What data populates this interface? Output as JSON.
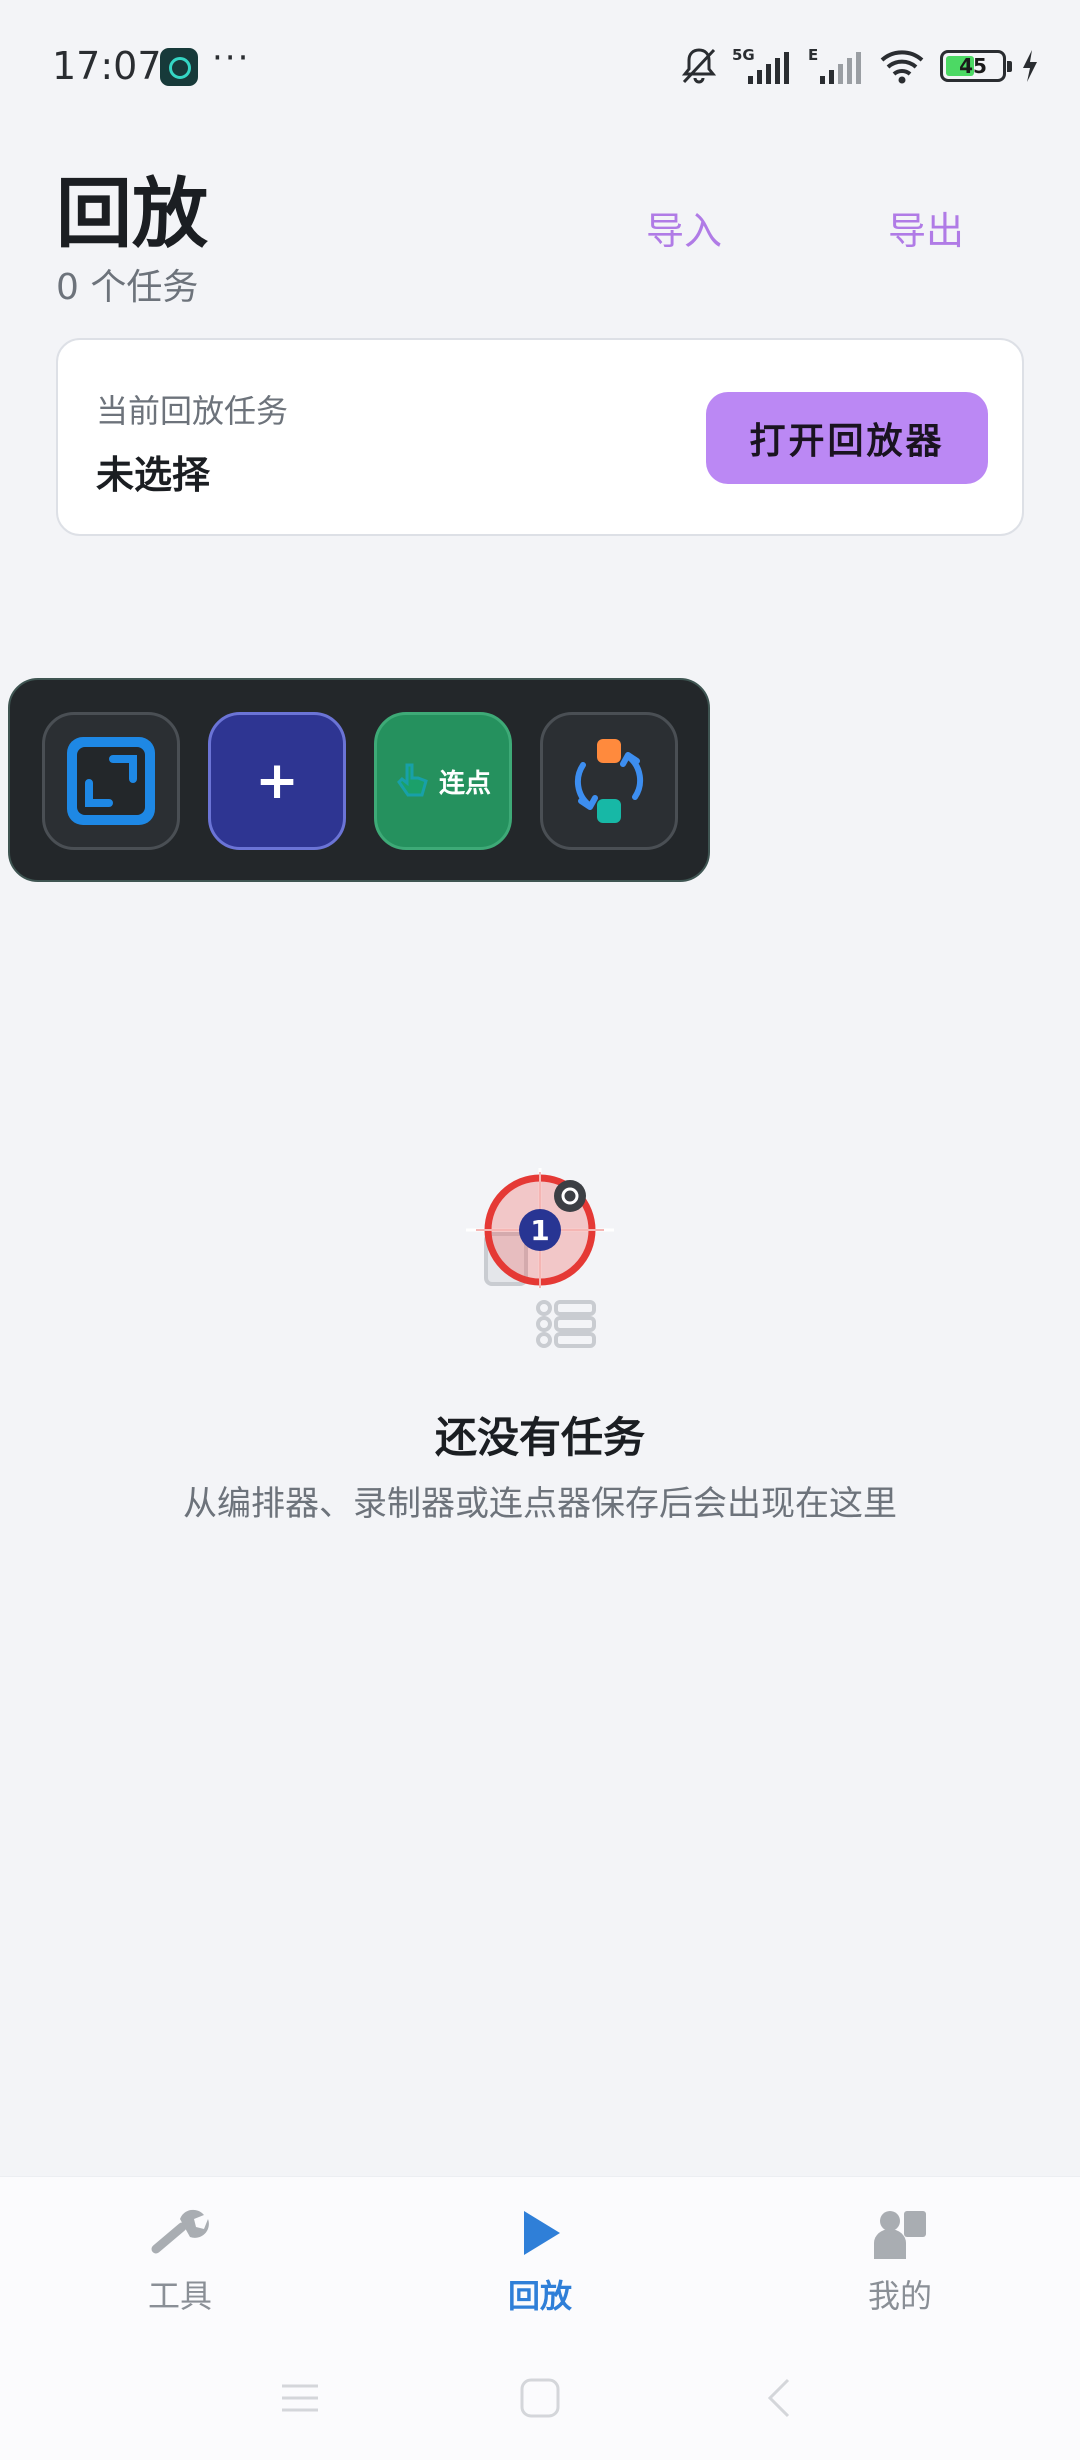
{
  "status_bar": {
    "time": "17:07",
    "more": "···",
    "battery_level": "45",
    "network": "5G",
    "network2": "E",
    "icons": [
      "app-badge-icon",
      "mute-bell-icon",
      "signal-icon",
      "wifi-icon",
      "battery-icon",
      "charging-icon"
    ]
  },
  "header": {
    "title": "回放",
    "task_count": "0 个任务",
    "import_label": "导入",
    "export_label": "导出"
  },
  "current_task": {
    "label": "当前回放任务",
    "value": "未选择",
    "open_button": "打开回放器"
  },
  "floating_toolbar": {
    "buttons": [
      {
        "name": "expand-icon"
      },
      {
        "name": "add-icon",
        "label": "+"
      },
      {
        "name": "auto-click-icon",
        "label": "连点"
      },
      {
        "name": "sync-icon"
      }
    ]
  },
  "empty_state": {
    "title": "还没有任务",
    "description": "从编排器、录制器或连点器保存后会出现在这里",
    "badge_number": "1"
  },
  "bottom_nav": {
    "items": [
      {
        "label": "工具",
        "icon": "wrench-icon",
        "active": false
      },
      {
        "label": "回放",
        "icon": "play-icon",
        "active": true
      },
      {
        "label": "我的",
        "icon": "profile-icon",
        "active": false
      }
    ]
  },
  "colors": {
    "accent_purple": "#bb88f4",
    "nav_active": "#2f7fd8",
    "background": "#f3f4f7"
  }
}
